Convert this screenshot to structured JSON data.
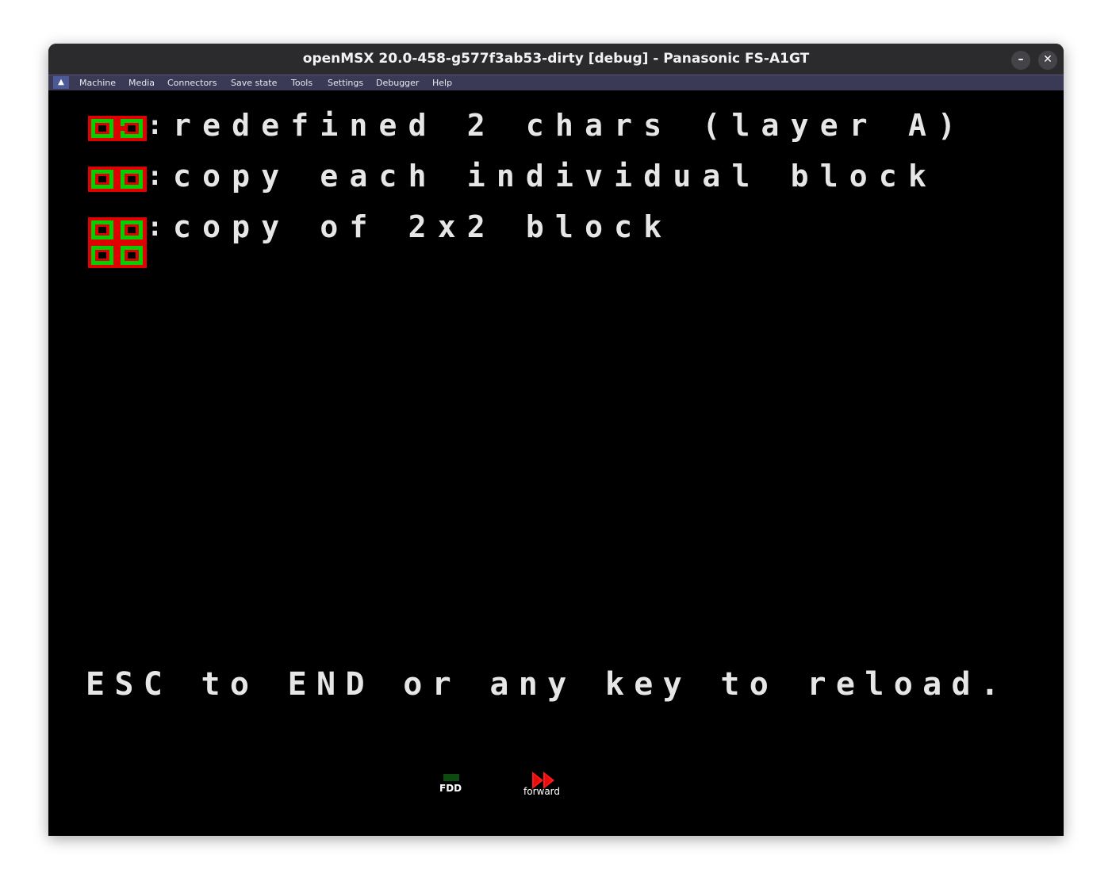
{
  "window": {
    "title": "openMSX 20.0-458-g577f3ab53-dirty [debug] - Panasonic FS-A1GT"
  },
  "titlebar": {
    "minimize_label": "–",
    "close_label": "✕"
  },
  "menu": {
    "toggle_label": "▲",
    "items": [
      "Machine",
      "Media",
      "Connectors",
      "Save state",
      "Tools",
      "Settings",
      "Debugger",
      "Help"
    ]
  },
  "screen": {
    "lines": [
      {
        "text": "redefined 2 chars (layer A)"
      },
      {
        "text": "copy each individual block"
      },
      {
        "text": "copy of 2x2 block"
      }
    ],
    "colon": ":",
    "footer": "ESC to END or any key to reload."
  },
  "status": {
    "fdd_label": "FDD",
    "forward_label": "forward"
  },
  "colors": {
    "tile_bg": "#e00000",
    "tile_fg": "#00d000",
    "tile_core": "#000000"
  }
}
